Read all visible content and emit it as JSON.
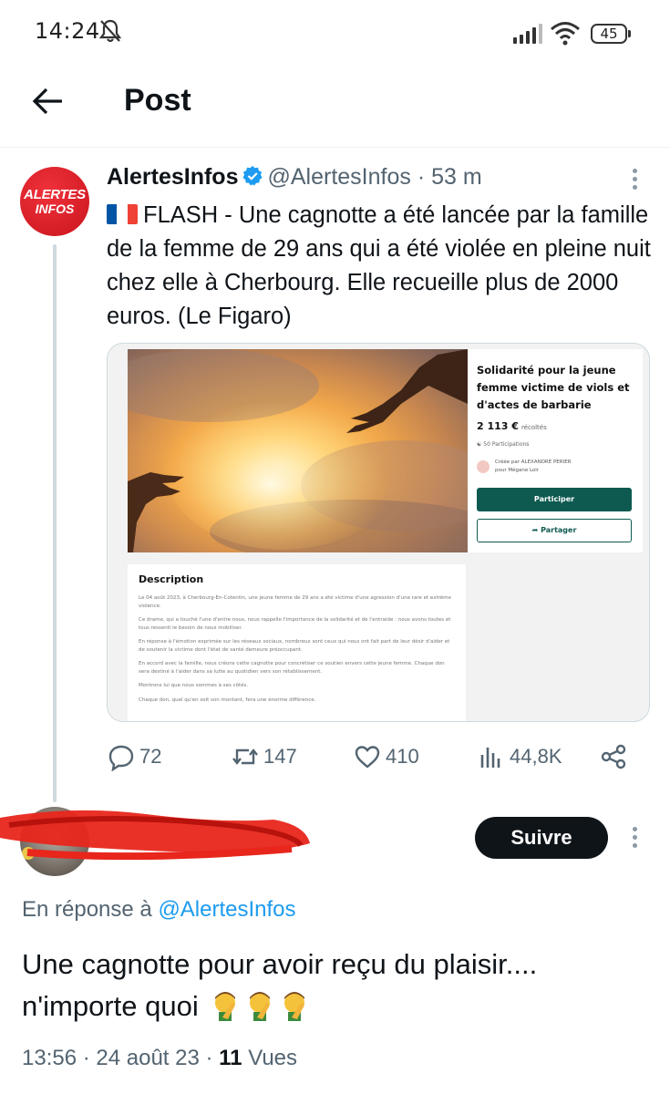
{
  "status_bar": {
    "time": "14:24",
    "battery": "45",
    "icons": [
      "bell-off-icon",
      "signal-icon",
      "wifi-icon",
      "battery-icon"
    ]
  },
  "header": {
    "title": "Post",
    "back_icon": "arrow-left-icon"
  },
  "tweet": {
    "avatar_text_top": "ALERTES",
    "avatar_text_bottom": "INFOS",
    "name": "AlertesInfos",
    "handle": "@AlertesInfos",
    "separator": " · ",
    "time": "53 m",
    "text_after_flag": "FLASH - Une cagnotte a été lancée par la famille de la femme de 29 ans qui a été violée en pleine nuit chez elle à Cherbourg. Elle recueille plus de 2000 euros. (Le Figaro)",
    "flag_colors": [
      "#0055a4",
      "#ffffff",
      "#ef4135"
    ],
    "accent_color": "#1d9bf0",
    "media": {
      "side_title": "Solidarité pour la jeune femme victime de viols et d'actes de barbarie",
      "amount": "2 113 €",
      "amount_suffix": "récoltés",
      "participations": "50 Participations",
      "creator_line1": "Créée par ALEXANDRE PERIER",
      "creator_line2": "pour Mégane Loir",
      "participate_button": "Participer",
      "share_button": "Partager",
      "description_title": "Description",
      "description_paragraphs": [
        "Le 04 août 2023, à Cherbourg-En-Cotentin, une jeune femme de 29 ans a été victime d'une agression d'une rare et extrême violence.",
        "Ce drame, qui a touché l'une d'entre nous, nous rappelle l'importance de la solidarité et de l'entraide : nous avons toutes et tous ressenti le besoin de nous mobiliser.",
        "En réponse à l'émotion exprimée sur les réseaux sociaux, nombreux sont ceux qui nous ont fait part de leur désir d'aider et de soutenir la victime dont l'état de santé demeure préoccupant.",
        "En accord avec la famille, nous créons cette cagnotte pour concrétiser ce soutien envers cette jeune femme. Chaque don sera destiné à l'aider dans sa lutte au quotidien vers son rétablissement.",
        "Montrons lui que nous sommes à ses côtés.",
        "Chaque don, quel qu'en soit son montant, fera une énorme différence."
      ],
      "brand_color": "#0e5a51"
    },
    "actions": {
      "replies": "72",
      "retweets": "147",
      "likes": "410",
      "views": "44,8K"
    }
  },
  "reply": {
    "follow_button": "Suivre",
    "reply_to_prefix": "En réponse à ",
    "reply_to_mention": "@AlertesInfos",
    "text": "Une cagnotte pour avoir reçu du plaisir.... n'importe quoi",
    "emoji": "man-facepalming-emoji",
    "time": "13:56",
    "date": "24 août 23",
    "views_count": "11",
    "views_label": "Vues",
    "scribble_color": "#e8261c"
  }
}
